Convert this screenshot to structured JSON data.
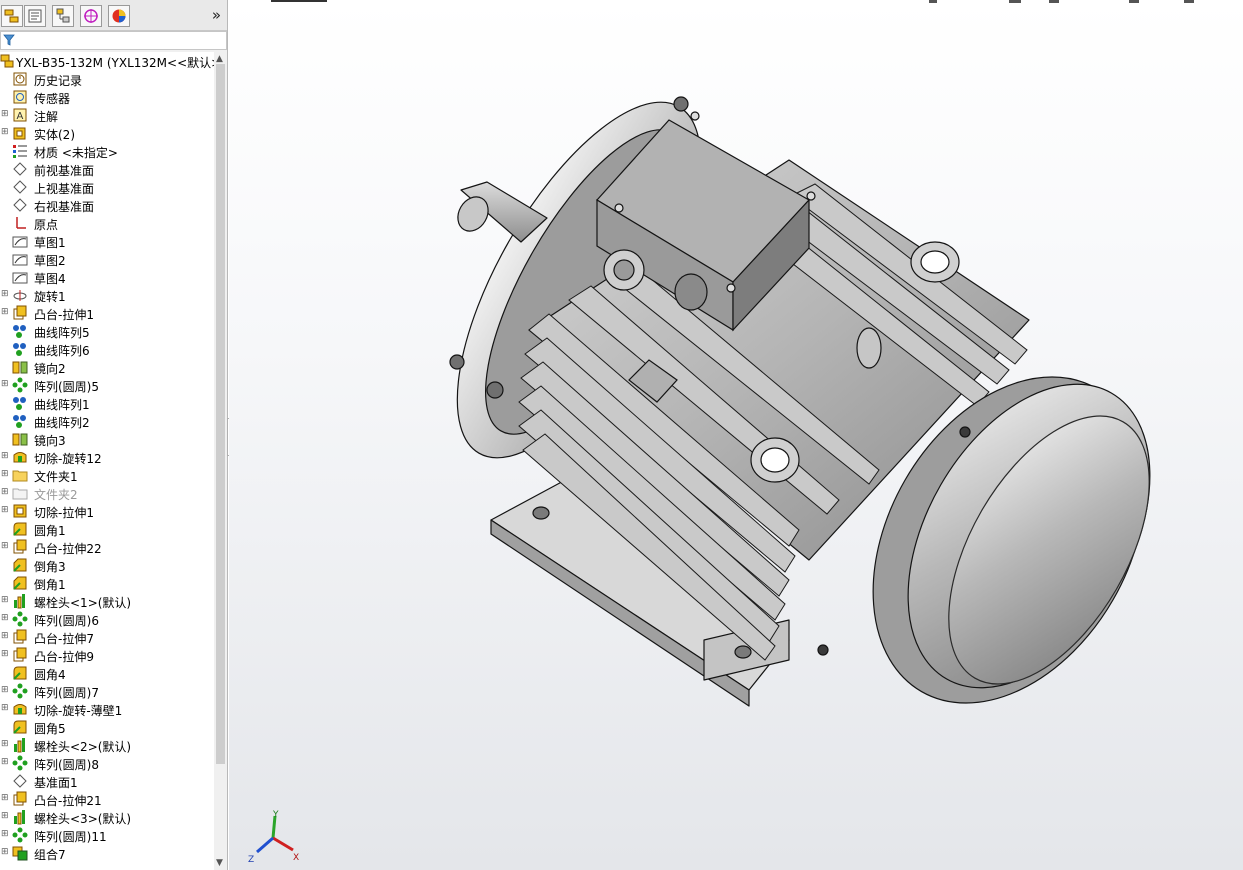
{
  "feature_tree": {
    "root": "YXL-B35-132M  (YXL132M<<默认>",
    "items": [
      {
        "label": "历史记录",
        "icon": "history-icon",
        "expandable": false
      },
      {
        "label": "传感器",
        "icon": "sensor-icon",
        "expandable": false
      },
      {
        "label": "注解",
        "icon": "annotation-icon",
        "expandable": true
      },
      {
        "label": "实体(2)",
        "icon": "solid-bodies-icon",
        "expandable": true
      },
      {
        "label": "材质 <未指定>",
        "icon": "material-icon",
        "expandable": false
      },
      {
        "label": "前视基准面",
        "icon": "plane-icon",
        "expandable": false
      },
      {
        "label": "上视基准面",
        "icon": "plane-icon",
        "expandable": false
      },
      {
        "label": "右视基准面",
        "icon": "plane-icon",
        "expandable": false
      },
      {
        "label": "原点",
        "icon": "origin-icon",
        "expandable": false
      },
      {
        "label": "草图1",
        "icon": "sketch-icon",
        "expandable": false
      },
      {
        "label": "草图2",
        "icon": "sketch-icon",
        "expandable": false
      },
      {
        "label": "草图4",
        "icon": "sketch-icon",
        "expandable": false
      },
      {
        "label": "旋转1",
        "icon": "revolve-icon",
        "expandable": true
      },
      {
        "label": "凸台-拉伸1",
        "icon": "boss-extrude-icon",
        "expandable": true
      },
      {
        "label": "曲线阵列5",
        "icon": "curve-pattern-icon",
        "expandable": false
      },
      {
        "label": "曲线阵列6",
        "icon": "curve-pattern-icon",
        "expandable": false
      },
      {
        "label": "镜向2",
        "icon": "mirror-icon",
        "expandable": false
      },
      {
        "label": "阵列(圆周)5",
        "icon": "circular-pattern-icon",
        "expandable": true
      },
      {
        "label": "曲线阵列1",
        "icon": "curve-pattern-icon",
        "expandable": false
      },
      {
        "label": "曲线阵列2",
        "icon": "curve-pattern-icon",
        "expandable": false
      },
      {
        "label": "镜向3",
        "icon": "mirror-icon",
        "expandable": false
      },
      {
        "label": "切除-旋转12",
        "icon": "cut-revolve-icon",
        "expandable": true
      },
      {
        "label": "文件夹1",
        "icon": "folder-icon",
        "expandable": true
      },
      {
        "label": "文件夹2",
        "icon": "folder-empty-icon",
        "expandable": true,
        "disabled": true
      },
      {
        "label": "切除-拉伸1",
        "icon": "cut-extrude-icon",
        "expandable": true
      },
      {
        "label": "圆角1",
        "icon": "fillet-icon",
        "expandable": false
      },
      {
        "label": "凸台-拉伸22",
        "icon": "boss-extrude-icon",
        "expandable": true
      },
      {
        "label": "倒角3",
        "icon": "chamfer-icon",
        "expandable": false
      },
      {
        "label": "倒角1",
        "icon": "chamfer-icon",
        "expandable": false
      },
      {
        "label": "螺栓头<1>(默认)",
        "icon": "library-feature-icon",
        "expandable": true
      },
      {
        "label": "阵列(圆周)6",
        "icon": "circular-pattern-icon",
        "expandable": true
      },
      {
        "label": "凸台-拉伸7",
        "icon": "boss-extrude-icon",
        "expandable": true
      },
      {
        "label": "凸台-拉伸9",
        "icon": "boss-extrude-icon",
        "expandable": true
      },
      {
        "label": "圆角4",
        "icon": "fillet-icon",
        "expandable": false
      },
      {
        "label": "阵列(圆周)7",
        "icon": "circular-pattern-icon",
        "expandable": true
      },
      {
        "label": "切除-旋转-薄壁1",
        "icon": "cut-revolve-icon",
        "expandable": true
      },
      {
        "label": "圆角5",
        "icon": "fillet-icon",
        "expandable": false
      },
      {
        "label": "螺栓头<2>(默认)",
        "icon": "library-feature-icon",
        "expandable": true
      },
      {
        "label": "阵列(圆周)8",
        "icon": "circular-pattern-icon",
        "expandable": true
      },
      {
        "label": "基准面1",
        "icon": "plane-icon",
        "expandable": false
      },
      {
        "label": "凸台-拉伸21",
        "icon": "boss-extrude-icon",
        "expandable": true
      },
      {
        "label": "螺栓头<3>(默认)",
        "icon": "library-feature-icon",
        "expandable": true
      },
      {
        "label": "阵列(圆周)11",
        "icon": "circular-pattern-icon",
        "expandable": true
      },
      {
        "label": "组合7",
        "icon": "combine-icon",
        "expandable": true
      }
    ]
  },
  "panel_tabs": [
    {
      "name": "feature-manager-tab",
      "icon": "feature-tree-icon"
    },
    {
      "name": "property-manager-tab",
      "icon": "property-icon"
    },
    {
      "name": "configuration-manager-tab",
      "icon": "configuration-icon"
    },
    {
      "name": "dimxpert-tab",
      "icon": "dimxpert-icon"
    },
    {
      "name": "display-manager-tab",
      "icon": "appearance-icon"
    }
  ],
  "panel_more": "»",
  "triad": {
    "x": "X",
    "y": "Y",
    "z": "Z"
  },
  "colors": {
    "accent_yellow": "#e8c000",
    "selection_blue": "#2f6fd6",
    "model_gray": "#b8b8b8"
  }
}
